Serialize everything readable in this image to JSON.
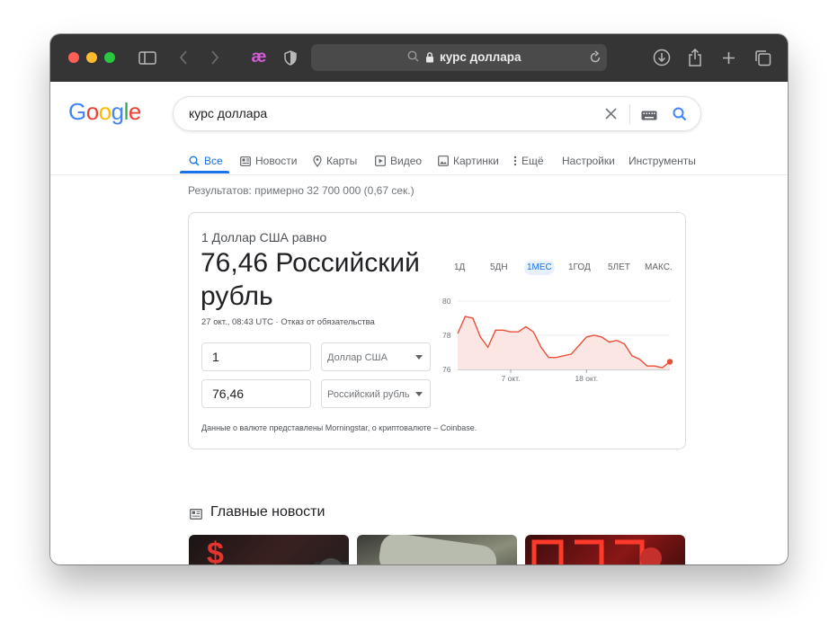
{
  "browser": {
    "address": "курс доллара",
    "extension_label": "æ"
  },
  "google": {
    "logo_letters": [
      {
        "char": "G",
        "color": "#4285f4"
      },
      {
        "char": "o",
        "color": "#ea4335"
      },
      {
        "char": "o",
        "color": "#fbbc05"
      },
      {
        "char": "g",
        "color": "#4285f4"
      },
      {
        "char": "l",
        "color": "#34a853"
      },
      {
        "char": "e",
        "color": "#ea4335"
      }
    ],
    "query": "курс доллара"
  },
  "tabs": {
    "all": "Все",
    "news": "Новости",
    "maps": "Карты",
    "video": "Видео",
    "images": "Картинки",
    "more": "Ещё",
    "settings": "Настройки",
    "tools": "Инструменты"
  },
  "results_stats": "Результатов: примерно 32 700 000 (0,67 сек.)",
  "converter": {
    "equals_label": "1 Доллар США равно",
    "result": "76,46 Российский рубль",
    "timestamp": "27 окт., 08:43 UTC · Отказ от обязательства",
    "from_amount": "1",
    "from_currency": "Доллар США",
    "to_amount": "76,46",
    "to_currency": "Российский рубль",
    "disclaimer": "Данные о валюте представлены Morningstar, о криптовалюте – Coinbase.",
    "ranges": [
      "1Д",
      "5ДН",
      "1МЕС",
      "1ГОД",
      "5ЛЕТ",
      "МАКС."
    ],
    "active_range": "1МЕС"
  },
  "chart_data": {
    "type": "area",
    "y_ticks": [
      "80",
      "78",
      "76"
    ],
    "ylim": [
      76,
      80
    ],
    "x_ticks": [
      "7 окт.",
      "18 окт."
    ],
    "values": [
      78.1,
      79.1,
      79.0,
      77.9,
      77.3,
      78.3,
      78.3,
      78.2,
      78.2,
      78.5,
      78.2,
      77.3,
      76.7,
      76.7,
      76.8,
      76.9,
      77.4,
      77.9,
      78.0,
      77.9,
      77.6,
      77.7,
      77.5,
      76.8,
      76.6,
      76.2,
      76.2,
      76.1,
      76.45
    ],
    "color": "#e8503a",
    "fill": "#fce6e3"
  },
  "news": {
    "heading": "Главные новости"
  }
}
